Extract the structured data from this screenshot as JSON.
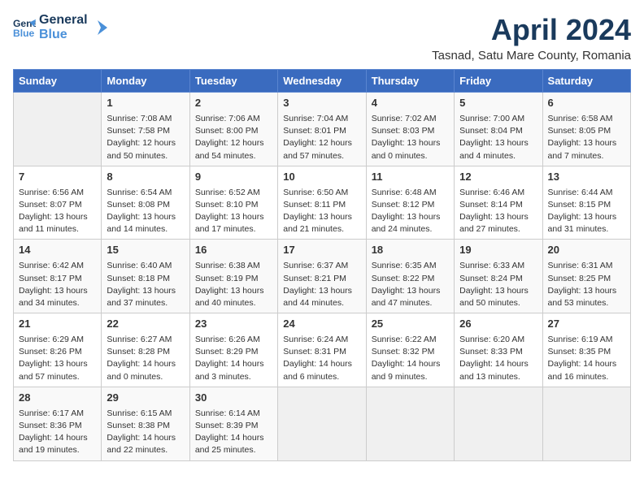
{
  "header": {
    "logo_line1": "General",
    "logo_line2": "Blue",
    "month_title": "April 2024",
    "location": "Tasnad, Satu Mare County, Romania"
  },
  "columns": [
    "Sunday",
    "Monday",
    "Tuesday",
    "Wednesday",
    "Thursday",
    "Friday",
    "Saturday"
  ],
  "weeks": [
    [
      {
        "day": "",
        "sunrise": "",
        "sunset": "",
        "daylight": ""
      },
      {
        "day": "1",
        "sunrise": "Sunrise: 7:08 AM",
        "sunset": "Sunset: 7:58 PM",
        "daylight": "Daylight: 12 hours and 50 minutes."
      },
      {
        "day": "2",
        "sunrise": "Sunrise: 7:06 AM",
        "sunset": "Sunset: 8:00 PM",
        "daylight": "Daylight: 12 hours and 54 minutes."
      },
      {
        "day": "3",
        "sunrise": "Sunrise: 7:04 AM",
        "sunset": "Sunset: 8:01 PM",
        "daylight": "Daylight: 12 hours and 57 minutes."
      },
      {
        "day": "4",
        "sunrise": "Sunrise: 7:02 AM",
        "sunset": "Sunset: 8:03 PM",
        "daylight": "Daylight: 13 hours and 0 minutes."
      },
      {
        "day": "5",
        "sunrise": "Sunrise: 7:00 AM",
        "sunset": "Sunset: 8:04 PM",
        "daylight": "Daylight: 13 hours and 4 minutes."
      },
      {
        "day": "6",
        "sunrise": "Sunrise: 6:58 AM",
        "sunset": "Sunset: 8:05 PM",
        "daylight": "Daylight: 13 hours and 7 minutes."
      }
    ],
    [
      {
        "day": "7",
        "sunrise": "Sunrise: 6:56 AM",
        "sunset": "Sunset: 8:07 PM",
        "daylight": "Daylight: 13 hours and 11 minutes."
      },
      {
        "day": "8",
        "sunrise": "Sunrise: 6:54 AM",
        "sunset": "Sunset: 8:08 PM",
        "daylight": "Daylight: 13 hours and 14 minutes."
      },
      {
        "day": "9",
        "sunrise": "Sunrise: 6:52 AM",
        "sunset": "Sunset: 8:10 PM",
        "daylight": "Daylight: 13 hours and 17 minutes."
      },
      {
        "day": "10",
        "sunrise": "Sunrise: 6:50 AM",
        "sunset": "Sunset: 8:11 PM",
        "daylight": "Daylight: 13 hours and 21 minutes."
      },
      {
        "day": "11",
        "sunrise": "Sunrise: 6:48 AM",
        "sunset": "Sunset: 8:12 PM",
        "daylight": "Daylight: 13 hours and 24 minutes."
      },
      {
        "day": "12",
        "sunrise": "Sunrise: 6:46 AM",
        "sunset": "Sunset: 8:14 PM",
        "daylight": "Daylight: 13 hours and 27 minutes."
      },
      {
        "day": "13",
        "sunrise": "Sunrise: 6:44 AM",
        "sunset": "Sunset: 8:15 PM",
        "daylight": "Daylight: 13 hours and 31 minutes."
      }
    ],
    [
      {
        "day": "14",
        "sunrise": "Sunrise: 6:42 AM",
        "sunset": "Sunset: 8:17 PM",
        "daylight": "Daylight: 13 hours and 34 minutes."
      },
      {
        "day": "15",
        "sunrise": "Sunrise: 6:40 AM",
        "sunset": "Sunset: 8:18 PM",
        "daylight": "Daylight: 13 hours and 37 minutes."
      },
      {
        "day": "16",
        "sunrise": "Sunrise: 6:38 AM",
        "sunset": "Sunset: 8:19 PM",
        "daylight": "Daylight: 13 hours and 40 minutes."
      },
      {
        "day": "17",
        "sunrise": "Sunrise: 6:37 AM",
        "sunset": "Sunset: 8:21 PM",
        "daylight": "Daylight: 13 hours and 44 minutes."
      },
      {
        "day": "18",
        "sunrise": "Sunrise: 6:35 AM",
        "sunset": "Sunset: 8:22 PM",
        "daylight": "Daylight: 13 hours and 47 minutes."
      },
      {
        "day": "19",
        "sunrise": "Sunrise: 6:33 AM",
        "sunset": "Sunset: 8:24 PM",
        "daylight": "Daylight: 13 hours and 50 minutes."
      },
      {
        "day": "20",
        "sunrise": "Sunrise: 6:31 AM",
        "sunset": "Sunset: 8:25 PM",
        "daylight": "Daylight: 13 hours and 53 minutes."
      }
    ],
    [
      {
        "day": "21",
        "sunrise": "Sunrise: 6:29 AM",
        "sunset": "Sunset: 8:26 PM",
        "daylight": "Daylight: 13 hours and 57 minutes."
      },
      {
        "day": "22",
        "sunrise": "Sunrise: 6:27 AM",
        "sunset": "Sunset: 8:28 PM",
        "daylight": "Daylight: 14 hours and 0 minutes."
      },
      {
        "day": "23",
        "sunrise": "Sunrise: 6:26 AM",
        "sunset": "Sunset: 8:29 PM",
        "daylight": "Daylight: 14 hours and 3 minutes."
      },
      {
        "day": "24",
        "sunrise": "Sunrise: 6:24 AM",
        "sunset": "Sunset: 8:31 PM",
        "daylight": "Daylight: 14 hours and 6 minutes."
      },
      {
        "day": "25",
        "sunrise": "Sunrise: 6:22 AM",
        "sunset": "Sunset: 8:32 PM",
        "daylight": "Daylight: 14 hours and 9 minutes."
      },
      {
        "day": "26",
        "sunrise": "Sunrise: 6:20 AM",
        "sunset": "Sunset: 8:33 PM",
        "daylight": "Daylight: 14 hours and 13 minutes."
      },
      {
        "day": "27",
        "sunrise": "Sunrise: 6:19 AM",
        "sunset": "Sunset: 8:35 PM",
        "daylight": "Daylight: 14 hours and 16 minutes."
      }
    ],
    [
      {
        "day": "28",
        "sunrise": "Sunrise: 6:17 AM",
        "sunset": "Sunset: 8:36 PM",
        "daylight": "Daylight: 14 hours and 19 minutes."
      },
      {
        "day": "29",
        "sunrise": "Sunrise: 6:15 AM",
        "sunset": "Sunset: 8:38 PM",
        "daylight": "Daylight: 14 hours and 22 minutes."
      },
      {
        "day": "30",
        "sunrise": "Sunrise: 6:14 AM",
        "sunset": "Sunset: 8:39 PM",
        "daylight": "Daylight: 14 hours and 25 minutes."
      },
      {
        "day": "",
        "sunrise": "",
        "sunset": "",
        "daylight": ""
      },
      {
        "day": "",
        "sunrise": "",
        "sunset": "",
        "daylight": ""
      },
      {
        "day": "",
        "sunrise": "",
        "sunset": "",
        "daylight": ""
      },
      {
        "day": "",
        "sunrise": "",
        "sunset": "",
        "daylight": ""
      }
    ]
  ]
}
